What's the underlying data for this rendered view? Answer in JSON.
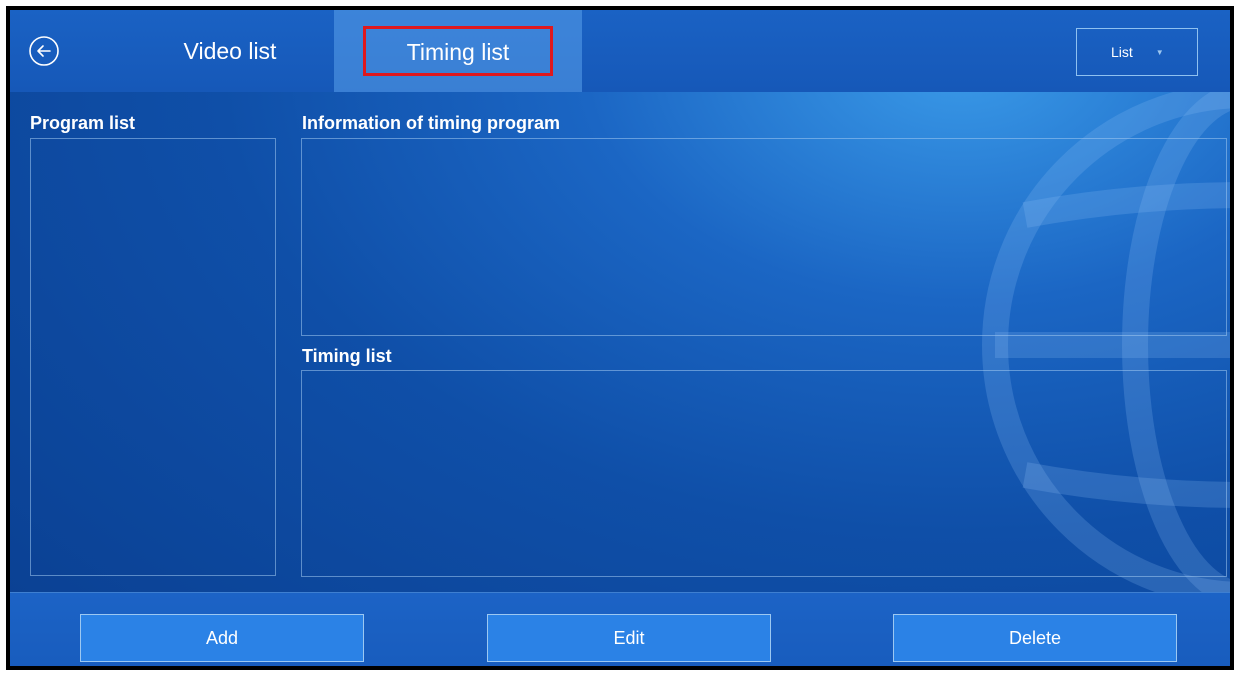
{
  "header": {
    "tabs": [
      {
        "label": "Video list",
        "active": false
      },
      {
        "label": "Timing list",
        "active": true
      }
    ],
    "view_select": {
      "value": "List"
    }
  },
  "left_panel": {
    "title": "Program list"
  },
  "info_panel": {
    "title": "Information of timing program"
  },
  "timing_panel": {
    "title": "Timing list"
  },
  "footer": {
    "add_label": "Add",
    "edit_label": "Edit",
    "delete_label": "Delete"
  },
  "colors": {
    "background": "#0f4fa8",
    "highlight_border": "#e0181d",
    "button": "#2b82e6"
  }
}
